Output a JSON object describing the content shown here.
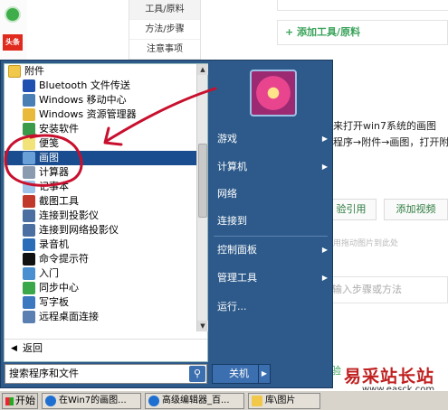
{
  "background": {
    "steps": [
      "工具/原料",
      "方法/步骤",
      "注意事项"
    ],
    "add_tool_label": "+ 添加工具/原料",
    "text_line1": "来打开win7系统的画图",
    "text_line2": "程序→附件→画图，打开附",
    "btn_quote": "验引用",
    "btn_video": "添加视频",
    "hint": "用拖动图片到此处",
    "step_placeholder": "输入步骤或方法",
    "more_label": "验",
    "watermark": "易采站长站",
    "watermark_url": "www.easck.com"
  },
  "start_menu": {
    "programs": [
      {
        "label": "附件",
        "type": "folder",
        "icon": "folder-icon"
      },
      {
        "label": "Bluetooth 文件传送",
        "type": "item",
        "icon": "bluetooth-icon",
        "color": "#1f4fb0"
      },
      {
        "label": "Windows 移动中心",
        "type": "item",
        "icon": "mobility-center-icon",
        "color": "#4a7fb5"
      },
      {
        "label": "Windows 资源管理器",
        "type": "item",
        "icon": "explorer-icon",
        "color": "#e8b93a"
      },
      {
        "label": "安装软件",
        "type": "item",
        "icon": "install-icon",
        "color": "#3a9b4a"
      },
      {
        "label": "便笺",
        "type": "item",
        "icon": "sticky-notes-icon",
        "color": "#f1e27a"
      },
      {
        "label": "画图",
        "type": "item",
        "icon": "paint-icon",
        "color": "#6aa0d8",
        "selected": true
      },
      {
        "label": "计算器",
        "type": "item",
        "icon": "calculator-icon",
        "color": "#8a9bb0"
      },
      {
        "label": "记事本",
        "type": "item",
        "icon": "notepad-icon",
        "color": "#9fc2e8"
      },
      {
        "label": "截图工具",
        "type": "item",
        "icon": "snipping-tool-icon",
        "color": "#c0392b"
      },
      {
        "label": "连接到投影仪",
        "type": "item",
        "icon": "projector-icon",
        "color": "#4a6fa0"
      },
      {
        "label": "连接到网络投影仪",
        "type": "item",
        "icon": "network-projector-icon",
        "color": "#4a6fa0"
      },
      {
        "label": "录音机",
        "type": "item",
        "icon": "sound-recorder-icon",
        "color": "#2b6cb8"
      },
      {
        "label": "命令提示符",
        "type": "item",
        "icon": "cmd-icon",
        "color": "#111111"
      },
      {
        "label": "入门",
        "type": "item",
        "icon": "getting-started-icon",
        "color": "#4a90d0"
      },
      {
        "label": "同步中心",
        "type": "item",
        "icon": "sync-center-icon",
        "color": "#3aa84a"
      },
      {
        "label": "写字板",
        "type": "item",
        "icon": "wordpad-icon",
        "color": "#3b78c0"
      },
      {
        "label": "远程桌面连接",
        "type": "item",
        "icon": "remote-desktop-icon",
        "color": "#5a7fb0"
      }
    ],
    "back_label": "返回",
    "search_placeholder": "搜索程序和文件",
    "right_items": [
      {
        "label": "游戏",
        "arrow": true
      },
      {
        "label": "计算机",
        "arrow": true
      },
      {
        "label": "网络",
        "arrow": false
      },
      {
        "label": "连接到",
        "arrow": false
      },
      {
        "label": "控制面板",
        "arrow": true
      },
      {
        "label": "管理工具",
        "arrow": true
      },
      {
        "label": "运行...",
        "arrow": false
      }
    ],
    "shutdown_label": "关机"
  },
  "taskbar": {
    "start_label": "开始",
    "tasks": [
      {
        "label": "在Win7的画图...",
        "icon": "ie-icon"
      },
      {
        "label": "高级编辑器_百...",
        "icon": "ie-icon"
      },
      {
        "label": "库\\图片",
        "icon": "folder-icon"
      }
    ]
  }
}
